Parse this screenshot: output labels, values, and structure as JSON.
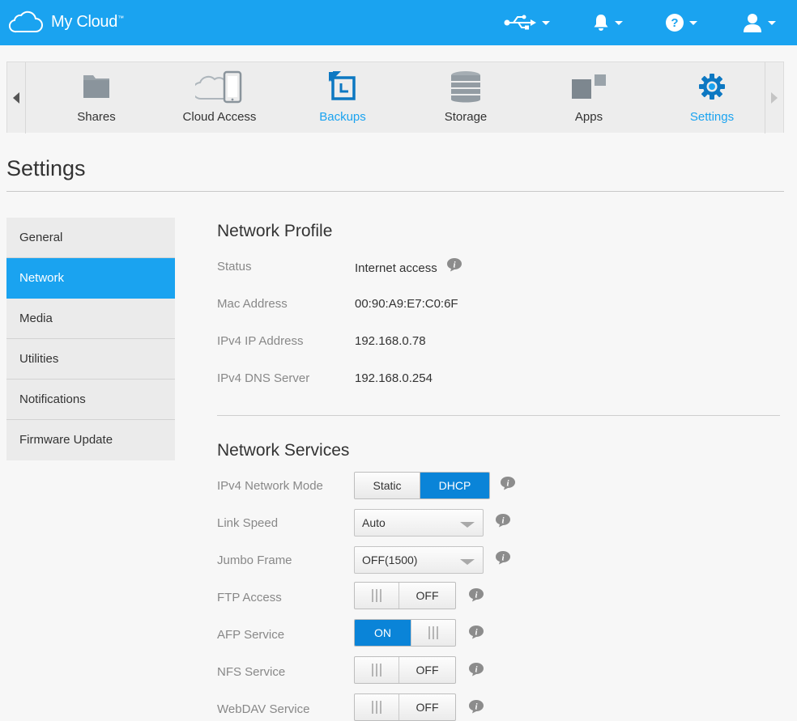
{
  "app": {
    "title": "My Cloud",
    "trademark": "™",
    "brand_color": "#1aa3f0",
    "accent_color": "#0a84d8"
  },
  "topbar": {
    "icons": [
      "usb-icon",
      "bell-icon",
      "help-icon",
      "user-icon"
    ]
  },
  "nav": {
    "items": [
      {
        "label": "Shares",
        "icon": "folder-icon"
      },
      {
        "label": "Cloud Access",
        "icon": "cloud-phone-icon"
      },
      {
        "label": "Backups",
        "icon": "backup-icon"
      },
      {
        "label": "Storage",
        "icon": "database-icon"
      },
      {
        "label": "Apps",
        "icon": "apps-icon"
      },
      {
        "label": "Settings",
        "icon": "gear-icon"
      }
    ],
    "active": "Settings"
  },
  "page": {
    "title": "Settings"
  },
  "sidebar": {
    "items": [
      {
        "label": "General"
      },
      {
        "label": "Network"
      },
      {
        "label": "Media"
      },
      {
        "label": "Utilities"
      },
      {
        "label": "Notifications"
      },
      {
        "label": "Firmware Update"
      }
    ],
    "active": "Network"
  },
  "network_profile": {
    "title": "Network Profile",
    "rows": [
      {
        "label": "Status",
        "value": "Internet access"
      },
      {
        "label": "Mac Address",
        "value": "00:90:A9:E7:C0:6F"
      },
      {
        "label": "IPv4 IP Address",
        "value": "192.168.0.78"
      },
      {
        "label": "IPv4 DNS Server",
        "value": "192.168.0.254"
      }
    ]
  },
  "network_services": {
    "title": "Network Services",
    "ipv4_mode": {
      "label": "IPv4 Network Mode",
      "options": [
        "Static",
        "DHCP"
      ],
      "selected": "DHCP"
    },
    "link_speed": {
      "label": "Link Speed",
      "value": "Auto"
    },
    "jumbo_frame": {
      "label": "Jumbo Frame",
      "value": "OFF(1500)"
    },
    "ftp": {
      "label": "FTP Access",
      "state": "OFF"
    },
    "afp": {
      "label": "AFP Service",
      "state": "ON"
    },
    "nfs": {
      "label": "NFS Service",
      "state": "OFF"
    },
    "webdav": {
      "label": "WebDAV Service",
      "state": "OFF"
    }
  }
}
